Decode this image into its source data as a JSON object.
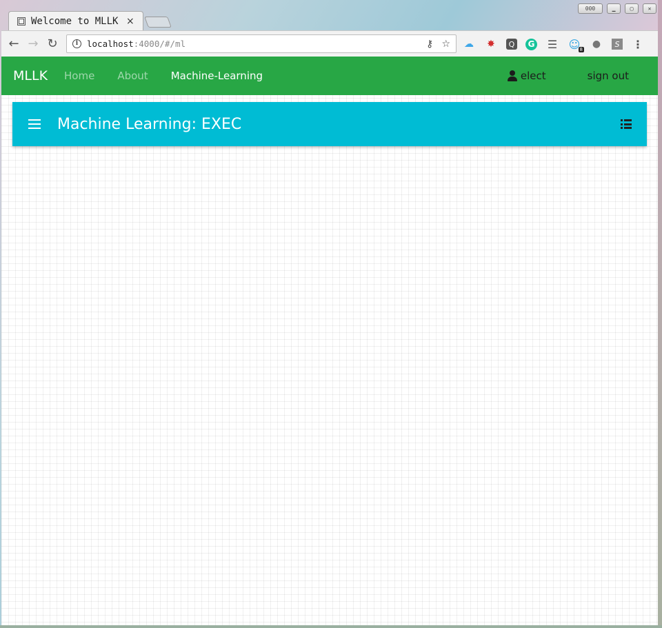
{
  "browser": {
    "tab_title": "Welcome to MLLK",
    "tab_close": "×",
    "window_buttons": {
      "menu_label": "000"
    },
    "url_host": "localhost",
    "url_rest": ":4000/#/ml",
    "extensions": [
      "cloud-icon",
      "bug-icon",
      "q-icon",
      "grammarly-icon",
      "lines-icon",
      "ghost-icon",
      "dots-icon",
      "s-icon"
    ],
    "ghost_badge": "8"
  },
  "navbar": {
    "brand": "MLLK",
    "links": [
      {
        "label": "Home",
        "active": false
      },
      {
        "label": "About",
        "active": false
      },
      {
        "label": "Machine-Learning",
        "active": true
      }
    ],
    "user_label": "elect",
    "signout_label": "sign out",
    "color": "#28a745"
  },
  "appbar": {
    "title": "Machine Learning: EXEC",
    "color": "#00bcd4"
  }
}
